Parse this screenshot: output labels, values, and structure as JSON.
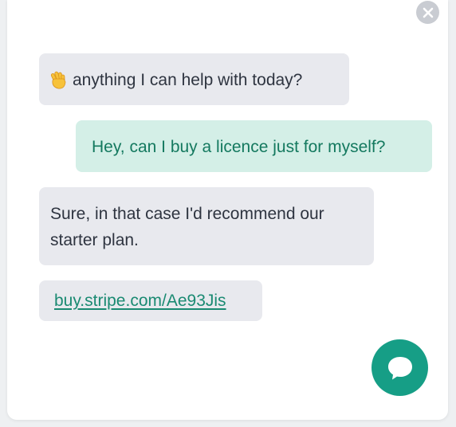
{
  "widget": {
    "close_icon": "close-icon",
    "chat_icon": "chat-bubble-icon",
    "accent_color": "#169e86",
    "user_bubble_color": "#d4efe7",
    "bot_bubble_color": "#e8e9ee"
  },
  "messages": [
    {
      "sender": "bot",
      "emoji": "waving-hand-icon",
      "text": "anything I can help with today?"
    },
    {
      "sender": "user",
      "text": "Hey, can I buy a licence just for myself?"
    },
    {
      "sender": "bot",
      "text": "Sure, in that case I'd recommend our starter plan."
    },
    {
      "sender": "bot",
      "link": "buy.stripe.com/Ae93Jis"
    }
  ]
}
